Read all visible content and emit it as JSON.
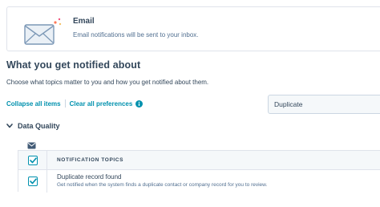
{
  "email_card": {
    "title": "Email",
    "description": "Email notifications will be sent to your inbox.",
    "icon": "envelope-icon"
  },
  "section": {
    "heading": "What you get notified about",
    "subtitle": "Choose what topics matter to you and how you get notified about them."
  },
  "actions": {
    "collapse_all": "Collapse all items",
    "clear_all": "Clear all preferences",
    "info_icon": "info-icon"
  },
  "search": {
    "value": "Duplicate"
  },
  "group": {
    "name": "Data Quality",
    "expanded": true,
    "channel_icon": "email-channel-icon"
  },
  "table": {
    "header": "NOTIFICATION TOPICS",
    "header_checked": true,
    "rows": [
      {
        "title": "Duplicate record found",
        "description": "Get notified when the system finds a duplicate contact or company record for you to review.",
        "checked": true
      }
    ]
  },
  "colors": {
    "accent": "#0091ae",
    "text": "#33475b",
    "muted": "#516f90",
    "border": "#dfe3eb",
    "sparkle_orange": "#ff7a59",
    "sparkle_pink": "#f2547d",
    "sparkle_yellow": "#f5c26b"
  }
}
